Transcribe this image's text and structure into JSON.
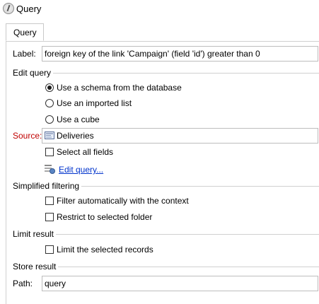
{
  "window": {
    "title": "Query"
  },
  "tabs": [
    {
      "label": "Query"
    }
  ],
  "label_field": {
    "label": "Label:",
    "value": "foreign key of the link 'Campaign' (field 'id') greater than 0"
  },
  "edit_query": {
    "title": "Edit query",
    "options": [
      {
        "label": "Use a schema from the database",
        "selected": true
      },
      {
        "label": "Use an imported list",
        "selected": false
      },
      {
        "label": "Use a cube",
        "selected": false
      }
    ],
    "source_label": "Source:",
    "source_value": "Deliveries",
    "select_all_label": "Select all fields",
    "select_all_checked": false,
    "edit_link": "Edit query..."
  },
  "simplified_filtering": {
    "title": "Simplified filtering",
    "filter_context_label": "Filter automatically with the context",
    "filter_context_checked": false,
    "restrict_folder_label": "Restrict to selected folder",
    "restrict_folder_checked": false
  },
  "limit_result": {
    "title": "Limit result",
    "limit_label": "Limit the selected records",
    "limit_checked": false
  },
  "store_result": {
    "title": "Store result",
    "path_label": "Path:",
    "path_value": "query"
  },
  "colors": {
    "source_label": "#c00000",
    "link": "#0033cc"
  }
}
